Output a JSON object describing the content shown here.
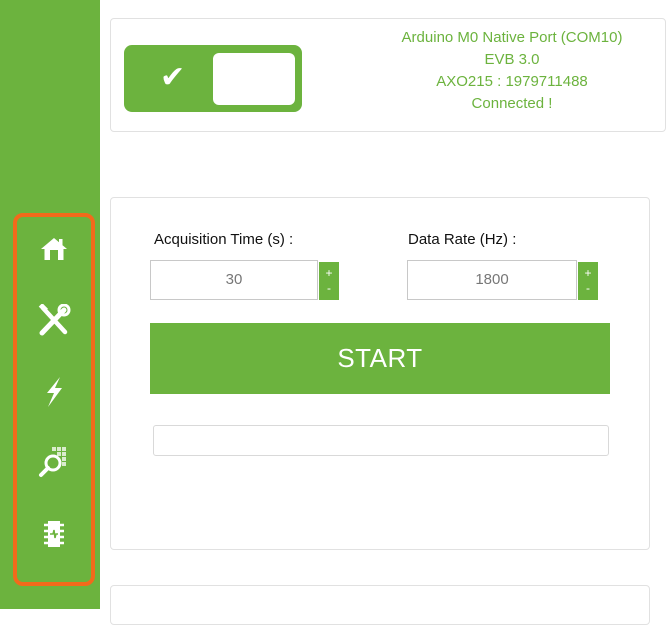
{
  "sidebar": {
    "items": [
      {
        "id": "home",
        "icon": "home-icon"
      },
      {
        "id": "tools",
        "icon": "tools-icon"
      },
      {
        "id": "power",
        "icon": "lightning-icon"
      },
      {
        "id": "scan",
        "icon": "magnifier-grid-icon"
      },
      {
        "id": "chip",
        "icon": "chip-icon"
      }
    ],
    "accent_color": "#6cb33e",
    "highlight_color": "#f26a1b"
  },
  "status": {
    "toggle_state": "on",
    "toggle_icon": "check-icon",
    "port": "Arduino M0 Native Port (COM10)",
    "board": "EVB 3.0",
    "device": "AXO215 : 1979711488",
    "connection": "Connected !"
  },
  "acquisition": {
    "time_label": "Acquisition Time (s) :",
    "time_value": "30",
    "rate_label": "Data Rate (Hz) :",
    "rate_value": "1800",
    "plus": "+",
    "minus": "-",
    "start_label": "START",
    "progress": 0
  }
}
